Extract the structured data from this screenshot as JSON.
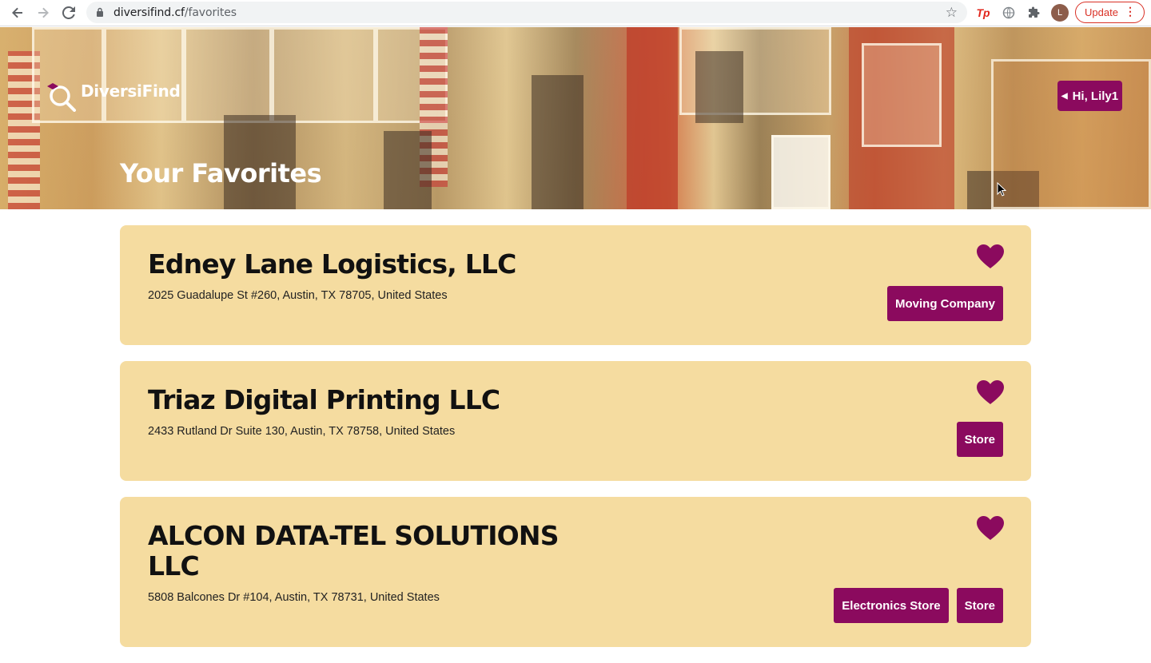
{
  "browser": {
    "url_host": "diversifind.cf",
    "url_path": "/favorites",
    "profile_initial": "L",
    "update_label": "Update",
    "extension_tp_label": "Tp"
  },
  "header": {
    "logo_text": "DiversiFind",
    "title": "Your Favorites",
    "user_greeting": "Hi, Lily1"
  },
  "favorites": [
    {
      "name": "Edney Lane Logistics, LLC",
      "address": "2025 Guadalupe St #260, Austin, TX 78705, United States",
      "tags": [
        "Moving Company"
      ],
      "favorited": true
    },
    {
      "name": "Triaz Digital Printing LLC",
      "address": "2433 Rutland Dr Suite 130, Austin, TX 78758, United States",
      "tags": [
        "Store"
      ],
      "favorited": true
    },
    {
      "name_line1": "ALCON DATA-TEL SOLUTIONS",
      "name_line2": "LLC",
      "address": "5808 Balcones Dr #104, Austin, TX 78731, United States",
      "tags": [
        "Electronics Store",
        "Store"
      ],
      "favorited": true
    }
  ],
  "colors": {
    "accent": "#8b0a5e",
    "card_bg": "#f5dca0"
  }
}
